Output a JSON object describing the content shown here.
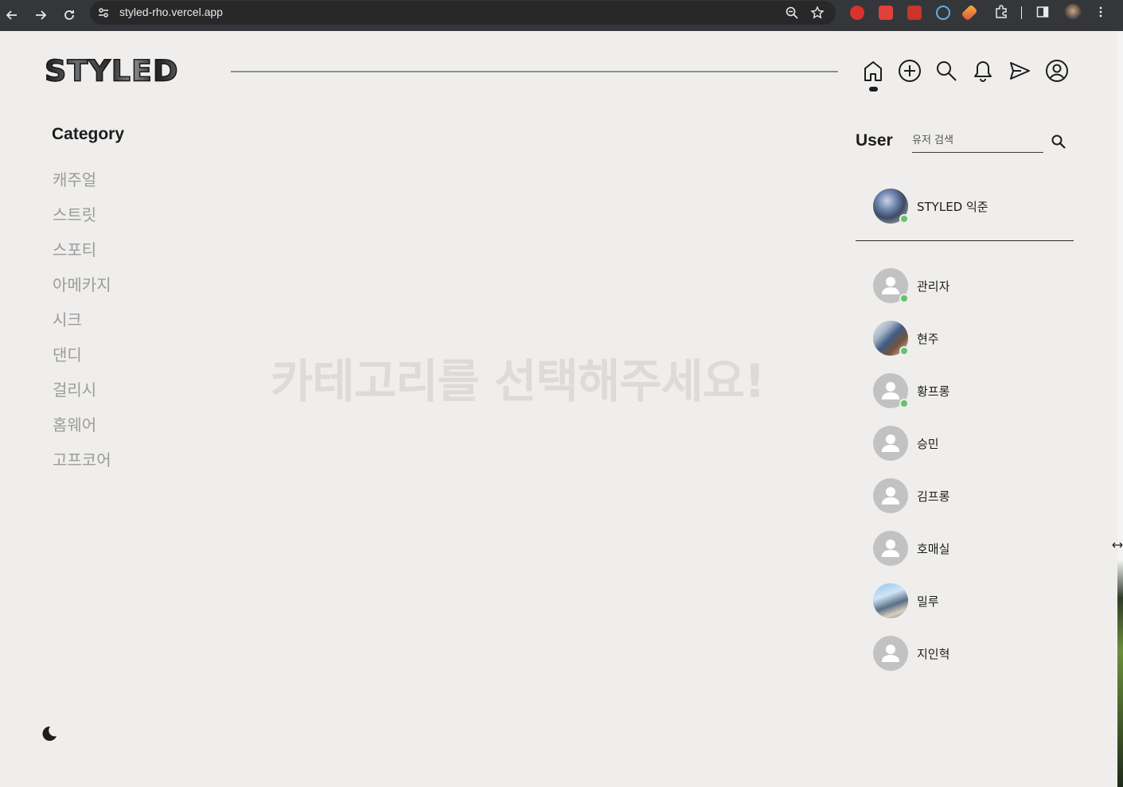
{
  "browser": {
    "url": "styled-rho.vercel.app"
  },
  "header": {
    "logo_text": "STYLED"
  },
  "category": {
    "title": "Category",
    "items": [
      "캐주얼",
      "스트릿",
      "스포티",
      "아메카지",
      "시크",
      "댄디",
      "걸리시",
      "홈웨어",
      "고프코어"
    ]
  },
  "main": {
    "message": "카테고리를 선택해주세요!"
  },
  "users": {
    "title": "User",
    "search_placeholder": "유저 검색",
    "me": {
      "name": "STYLED 익준",
      "online": true
    },
    "list": [
      {
        "name": "관리자",
        "online": true
      },
      {
        "name": "현주",
        "online": true
      },
      {
        "name": "황프롱",
        "online": true
      },
      {
        "name": "승민",
        "online": false
      },
      {
        "name": "김프롱",
        "online": false
      },
      {
        "name": "호매실",
        "online": false
      },
      {
        "name": "밀루",
        "online": false
      },
      {
        "name": "지인혁",
        "online": false
      }
    ]
  },
  "colors": {
    "accent": "#1d1d1d",
    "online": "#64c36c",
    "muted_text": "#9b9b9b",
    "background": "#efeeec"
  }
}
